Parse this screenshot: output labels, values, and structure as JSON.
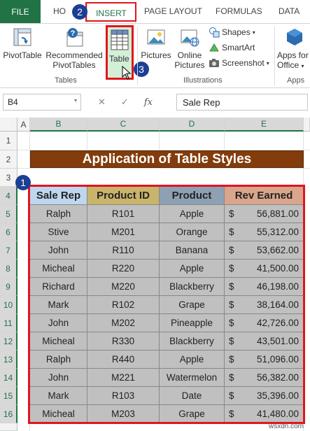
{
  "ribbon_tabs": {
    "file": "FILE",
    "home": "HO",
    "insert": "INSERT",
    "page_layout": "PAGE LAYOUT",
    "formulas": "FORMULAS",
    "data": "DATA"
  },
  "ribbon": {
    "pivottable": "PivotTable",
    "recommended_pivottables_line1": "Recommended",
    "recommended_pivottables_line2": "PivotTables",
    "table": "Table",
    "tables_group": "Tables",
    "pictures": "Pictures",
    "online_pictures_line1": "Online",
    "online_pictures_line2": "Pictures",
    "shapes": "Shapes",
    "smartart": "SmartArt",
    "screenshot": "Screenshot",
    "illustrations_group": "Illustrations",
    "apps_for_office_line1": "Apps for",
    "apps_for_office_line2": "Office",
    "apps_group": "Apps"
  },
  "formula_bar": {
    "name_box": "B4",
    "cancel": "✕",
    "enter": "✓",
    "fx": "fx",
    "value": "Sale Rep"
  },
  "columns": [
    "A",
    "B",
    "C",
    "D",
    "E"
  ],
  "rows": [
    "1",
    "2",
    "3",
    "4",
    "5",
    "6",
    "7",
    "8",
    "9",
    "10",
    "11",
    "12",
    "13",
    "14",
    "15",
    "16"
  ],
  "title": "Application of Table Styles",
  "table": {
    "headers": [
      "Sale Rep",
      "Product ID",
      "Product",
      "Rev Earned"
    ],
    "header_colors": [
      "#bdd7ee",
      "#c9b46b",
      "#8ea0b4",
      "#d9a58c"
    ],
    "currency": "$",
    "rows": [
      [
        "Ralph",
        "R101",
        "Apple",
        "56,881.00"
      ],
      [
        "Stive",
        "M201",
        "Orange",
        "55,312.00"
      ],
      [
        "John",
        "R110",
        "Banana",
        "53,662.00"
      ],
      [
        "Micheal",
        "R220",
        "Apple",
        "41,500.00"
      ],
      [
        "Richard",
        "M220",
        "Blackberry",
        "46,198.00"
      ],
      [
        "Mark",
        "R102",
        "Grape",
        "38,164.00"
      ],
      [
        "John",
        "M202",
        "Pineapple",
        "42,726.00"
      ],
      [
        "Micheal",
        "R330",
        "Blackberry",
        "43,501.00"
      ],
      [
        "Ralph",
        "R440",
        "Apple",
        "51,096.00"
      ],
      [
        "John",
        "M221",
        "Watermelon",
        "56,382.00"
      ],
      [
        "Mark",
        "R103",
        "Date",
        "35,396.00"
      ],
      [
        "Micheal",
        "M203",
        "Grape",
        "41,480.00"
      ]
    ]
  },
  "badges": {
    "one": "1",
    "two": "2",
    "three": "3"
  },
  "watermark": "wsxdn.com",
  "colors": {
    "excel_green": "#217346",
    "title_bg": "#833c0b",
    "callout_red": "#e0161d",
    "badge_blue": "#1c3f94",
    "cell_grey": "#c0c0c0"
  }
}
